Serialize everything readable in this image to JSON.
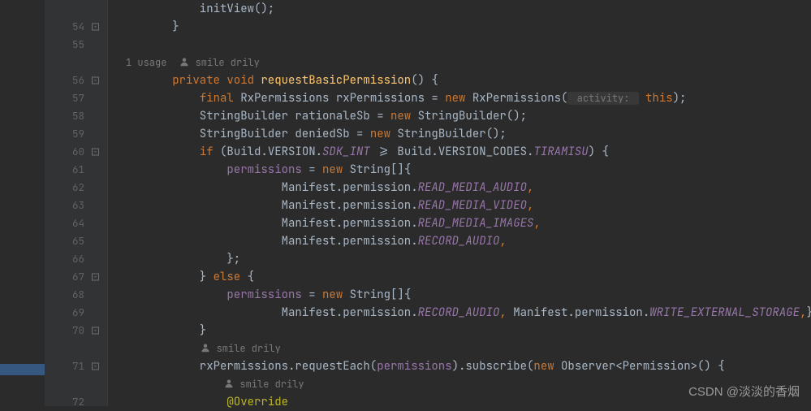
{
  "author": "smile drily",
  "usage_text": "1 usage",
  "watermark": "CSDN @淡淡的香烟",
  "lines": [
    {
      "n": "",
      "seg": [
        {
          "c": "punct",
          "t": "            initView();"
        }
      ]
    },
    {
      "n": "54",
      "fold": "close",
      "seg": [
        {
          "c": "brace",
          "t": "        }"
        }
      ]
    },
    {
      "n": "55",
      "seg": []
    },
    {
      "n": "",
      "inlay": true
    },
    {
      "n": "56",
      "fold": "open",
      "seg": [
        {
          "c": "punct",
          "t": "        "
        },
        {
          "c": "kw",
          "t": "private "
        },
        {
          "c": "kw",
          "t": "void "
        },
        {
          "c": "method-decl",
          "t": "requestBasicPermission"
        },
        {
          "c": "paren",
          "t": "() {"
        }
      ]
    },
    {
      "n": "57",
      "seg": [
        {
          "c": "punct",
          "t": "            "
        },
        {
          "c": "kw-final",
          "t": "final "
        },
        {
          "c": "type",
          "t": "RxPermissions rxPermissions = "
        },
        {
          "c": "kw",
          "t": "new "
        },
        {
          "c": "type",
          "t": "RxPermissions("
        },
        {
          "c": "hint",
          "t": " activity: "
        },
        {
          "c": "punct",
          "t": " "
        },
        {
          "c": "this",
          "t": "this"
        },
        {
          "c": "punct",
          "t": ");"
        }
      ]
    },
    {
      "n": "58",
      "seg": [
        {
          "c": "punct",
          "t": "            StringBuilder rationaleSb = "
        },
        {
          "c": "kw",
          "t": "new "
        },
        {
          "c": "type",
          "t": "StringBuilder();"
        }
      ]
    },
    {
      "n": "59",
      "seg": [
        {
          "c": "punct",
          "t": "            StringBuilder deniedSb = "
        },
        {
          "c": "kw",
          "t": "new "
        },
        {
          "c": "type",
          "t": "StringBuilder();"
        }
      ]
    },
    {
      "n": "60",
      "fold": "open",
      "seg": [
        {
          "c": "punct",
          "t": "            "
        },
        {
          "c": "kw",
          "t": "if "
        },
        {
          "c": "punct",
          "t": "(Build.VERSION."
        },
        {
          "c": "constant",
          "t": "SDK_INT"
        },
        {
          "c": "punct",
          "t": " >= Build.VERSION_CODES."
        },
        {
          "c": "constant",
          "t": "TIRAMISU"
        },
        {
          "c": "punct",
          "t": ") {"
        }
      ]
    },
    {
      "n": "61",
      "seg": [
        {
          "c": "punct",
          "t": "                "
        },
        {
          "c": "field",
          "t": "permissions"
        },
        {
          "c": "punct",
          "t": " = "
        },
        {
          "c": "kw",
          "t": "new "
        },
        {
          "c": "type",
          "t": "String[]{"
        }
      ]
    },
    {
      "n": "62",
      "seg": [
        {
          "c": "punct",
          "t": "                        Manifest.permission."
        },
        {
          "c": "constant",
          "t": "READ_MEDIA_AUDIO"
        },
        {
          "c": "kw",
          "t": ","
        }
      ]
    },
    {
      "n": "63",
      "seg": [
        {
          "c": "punct",
          "t": "                        Manifest.permission."
        },
        {
          "c": "constant",
          "t": "READ_MEDIA_VIDEO"
        },
        {
          "c": "kw",
          "t": ","
        }
      ]
    },
    {
      "n": "64",
      "seg": [
        {
          "c": "punct",
          "t": "                        Manifest.permission."
        },
        {
          "c": "constant",
          "t": "READ_MEDIA_IMAGES"
        },
        {
          "c": "kw",
          "t": ","
        }
      ]
    },
    {
      "n": "65",
      "seg": [
        {
          "c": "punct",
          "t": "                        Manifest.permission."
        },
        {
          "c": "constant",
          "t": "RECORD_AUDIO"
        },
        {
          "c": "kw",
          "t": ","
        }
      ]
    },
    {
      "n": "66",
      "seg": [
        {
          "c": "punct",
          "t": "                };"
        }
      ]
    },
    {
      "n": "67",
      "fold": "open",
      "seg": [
        {
          "c": "punct",
          "t": "            } "
        },
        {
          "c": "kw",
          "t": "else "
        },
        {
          "c": "punct",
          "t": "{"
        }
      ]
    },
    {
      "n": "68",
      "seg": [
        {
          "c": "punct",
          "t": "                "
        },
        {
          "c": "field",
          "t": "permissions"
        },
        {
          "c": "punct",
          "t": " = "
        },
        {
          "c": "kw",
          "t": "new "
        },
        {
          "c": "type",
          "t": "String[]{"
        }
      ]
    },
    {
      "n": "69",
      "seg": [
        {
          "c": "punct",
          "t": "                        Manifest.permission."
        },
        {
          "c": "constant",
          "t": "RECORD_AUDIO"
        },
        {
          "c": "kw",
          "t": ","
        },
        {
          "c": "punct",
          "t": " Manifest.permission."
        },
        {
          "c": "constant",
          "t": "WRITE_EXTERNAL_STORAGE"
        },
        {
          "c": "kw",
          "t": ","
        },
        {
          "c": "punct",
          "t": "};"
        }
      ]
    },
    {
      "n": "70",
      "fold": "close",
      "seg": [
        {
          "c": "punct",
          "t": "            }"
        }
      ]
    },
    {
      "n": "",
      "inlay_author_only": true,
      "indent": "            "
    },
    {
      "n": "71",
      "fold": "open",
      "seg": [
        {
          "c": "punct",
          "t": "            rxPermissions.requestEach("
        },
        {
          "c": "field",
          "t": "permissions"
        },
        {
          "c": "punct",
          "t": ").subscribe("
        },
        {
          "c": "kw",
          "t": "new "
        },
        {
          "c": "type",
          "t": "Observer<Permission>() {"
        }
      ]
    },
    {
      "n": "",
      "inlay_author_only": true,
      "indent": "                "
    },
    {
      "n": "72",
      "seg": [
        {
          "c": "punct",
          "t": "                "
        },
        {
          "c": "anno",
          "t": "@Override"
        }
      ]
    }
  ]
}
